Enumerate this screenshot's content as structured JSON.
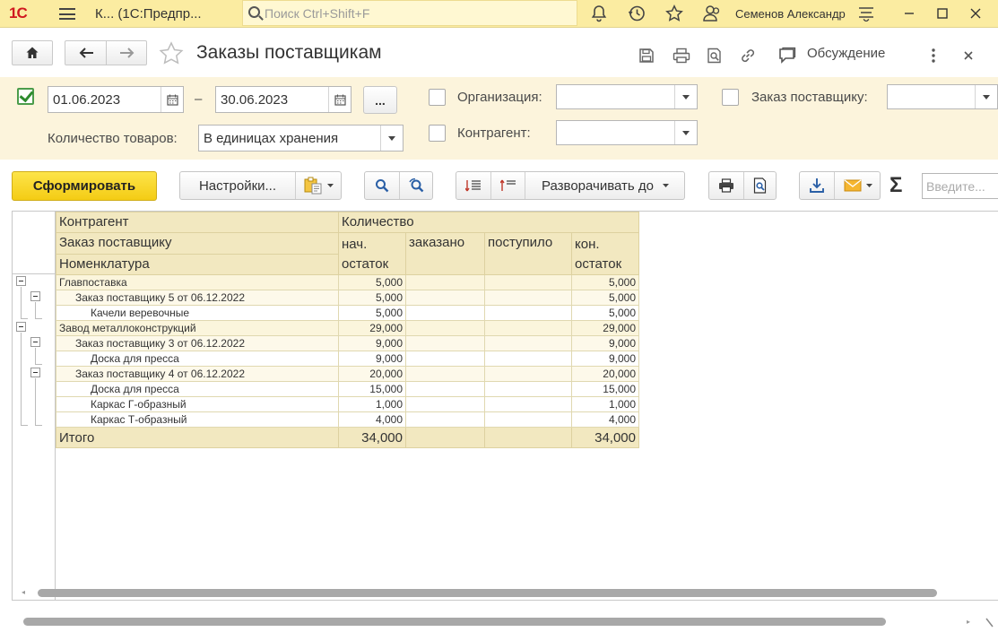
{
  "topbar": {
    "logo": "1С",
    "app_title": "К... (1С:Предпр...",
    "search_placeholder": "Поиск Ctrl+Shift+F",
    "user_name": "Семенов Александр"
  },
  "form": {
    "title": "Заказы поставщикам",
    "discuss_label": "Обсуждение"
  },
  "filters": {
    "period_enabled": true,
    "date_from": "01.06.2023",
    "dash": "–",
    "date_to": "30.06.2023",
    "more_label": "...",
    "quantity_label": "Количество товаров:",
    "quantity_value": "В единицах хранения",
    "organization_label": "Организация:",
    "organization_value": "",
    "supplier_order_label": "Заказ поставщику:",
    "supplier_order_value": "",
    "counterparty_label": "Контрагент:",
    "counterparty_value": ""
  },
  "toolbar": {
    "generate_label": "Сформировать",
    "settings_label": "Настройки...",
    "expand_label": "Разворачивать до",
    "quick_search_placeholder": "Введите..."
  },
  "report": {
    "header": {
      "counterparty": "Контрагент",
      "supplier_order": "Заказ поставщику",
      "nomenclature": "Номенклатура",
      "quantity": "Количество",
      "col_start_line1": "нач.",
      "col_start_line2": "остаток",
      "col_ordered": "заказано",
      "col_received": "поступило",
      "col_end_line1": "кон.",
      "col_end_line2": "остаток"
    },
    "rows": [
      {
        "name": "Главпоставка",
        "start": "5,000",
        "ordered": "",
        "received": "",
        "end": "5,000"
      },
      {
        "name": "Заказ поставщику 5 от 06.12.2022",
        "start": "5,000",
        "ordered": "",
        "received": "",
        "end": "5,000"
      },
      {
        "name": "Качели веревочные",
        "start": "5,000",
        "ordered": "",
        "received": "",
        "end": "5,000"
      },
      {
        "name": "Завод металлоконструкций",
        "start": "29,000",
        "ordered": "",
        "received": "",
        "end": "29,000"
      },
      {
        "name": "Заказ поставщику 3 от 06.12.2022",
        "start": "9,000",
        "ordered": "",
        "received": "",
        "end": "9,000"
      },
      {
        "name": "Доска для пресса",
        "start": "9,000",
        "ordered": "",
        "received": "",
        "end": "9,000"
      },
      {
        "name": "Заказ поставщику 4 от 06.12.2022",
        "start": "20,000",
        "ordered": "",
        "received": "",
        "end": "20,000"
      },
      {
        "name": "Доска для пресса",
        "start": "15,000",
        "ordered": "",
        "received": "",
        "end": "15,000"
      },
      {
        "name": "Каркас Г-образный",
        "start": "1,000",
        "ordered": "",
        "received": "",
        "end": "1,000"
      },
      {
        "name": "Каркас Т-образный",
        "start": "4,000",
        "ordered": "",
        "received": "",
        "end": "4,000"
      }
    ],
    "total": {
      "label": "Итого",
      "start": "34,000",
      "ordered": "",
      "received": "",
      "end": "34,000"
    }
  }
}
